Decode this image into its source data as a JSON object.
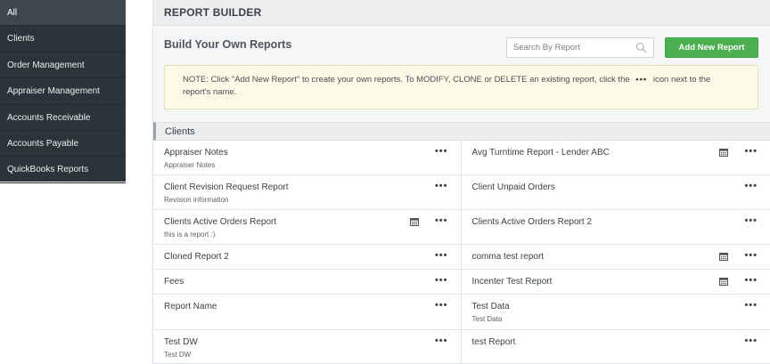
{
  "sidebar": {
    "items": [
      {
        "label": "All"
      },
      {
        "label": "Clients"
      },
      {
        "label": "Order Management"
      },
      {
        "label": "Appraiser Management"
      },
      {
        "label": "Accounts Receivable"
      },
      {
        "label": "Accounts Payable"
      },
      {
        "label": "QuickBooks Reports"
      }
    ],
    "active_index": 0
  },
  "header": {
    "title": "REPORT BUILDER"
  },
  "toolbar": {
    "subtitle": "Build Your Own Reports",
    "search_placeholder": "Search By Report",
    "add_button_label": "Add New Report"
  },
  "note": {
    "before": "NOTE: Click \"Add New Report\" to create your own reports. To MODIFY, CLONE or DELETE an existing report, click the",
    "dots": "•••",
    "after": "icon next to the report's name."
  },
  "section": {
    "title": "Clients"
  },
  "reports_left": [
    {
      "name": "Appraiser Notes",
      "desc": "Appraiser Notes",
      "scheduled": false
    },
    {
      "name": "Client Revision Request Report",
      "desc": "Revision information",
      "scheduled": false
    },
    {
      "name": "Clients Active Orders Report",
      "desc": "this is a report :)",
      "scheduled": true
    },
    {
      "name": "Cloned Report 2",
      "desc": "",
      "scheduled": false
    },
    {
      "name": "Fees",
      "desc": "",
      "scheduled": false
    },
    {
      "name": "Report Name",
      "desc": "",
      "scheduled": false
    },
    {
      "name": "Test DW",
      "desc": "Test DW",
      "scheduled": false
    }
  ],
  "reports_right": [
    {
      "name": "Avg Turntime Report - Lender ABC",
      "desc": "",
      "scheduled": true
    },
    {
      "name": "Client Unpaid Orders",
      "desc": "",
      "scheduled": false
    },
    {
      "name": "Clients Active Orders Report 2",
      "desc": "",
      "scheduled": false
    },
    {
      "name": "comma test report",
      "desc": "",
      "scheduled": true
    },
    {
      "name": "Incenter Test Report",
      "desc": "",
      "scheduled": true
    },
    {
      "name": "Test Data",
      "desc": "Test Data",
      "scheduled": false
    },
    {
      "name": "test Report",
      "desc": "",
      "scheduled": false
    }
  ],
  "menu_glyph": "•••",
  "icons": {
    "calendar": "calendar-icon",
    "search": "search-icon"
  },
  "colors": {
    "sidebar_bg": "#2b3438",
    "accent_green": "#4caf50",
    "note_bg": "#fdfbe7"
  }
}
